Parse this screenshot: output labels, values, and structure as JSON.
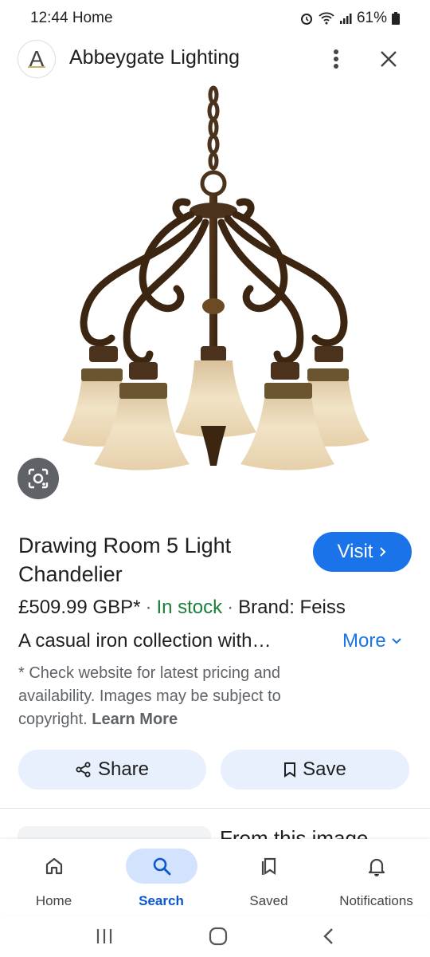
{
  "status_bar": {
    "time": "12:44",
    "label": "Home",
    "battery": "61%"
  },
  "header": {
    "logo_letter": "A",
    "site_name": "Abbeygate Lighting"
  },
  "product": {
    "title": "Drawing Room 5 Light Chandelier",
    "visit_label": "Visit",
    "price": "£509.99 GBP*",
    "stock": "In stock",
    "brand": "Brand: Feiss",
    "description": "A casual iron collection with…",
    "more_label": "More",
    "disclaimer": "* Check website for latest pricing and availability. Images may be subject to copyright.",
    "learn_more": "Learn More"
  },
  "actions": {
    "share_label": "Share",
    "save_label": "Save"
  },
  "related": {
    "title": "From this image"
  },
  "bottom_nav": [
    {
      "label": "Home",
      "icon": "home-icon"
    },
    {
      "label": "Search",
      "icon": "search-icon",
      "active": true
    },
    {
      "label": "Saved",
      "icon": "saved-icon"
    },
    {
      "label": "Notifications",
      "icon": "bell-icon"
    }
  ],
  "colors": {
    "accent": "#1a73e8",
    "stock_green": "#188038",
    "chip_bg": "#e8f0fe",
    "nav_active_bg": "#d3e3fd"
  }
}
